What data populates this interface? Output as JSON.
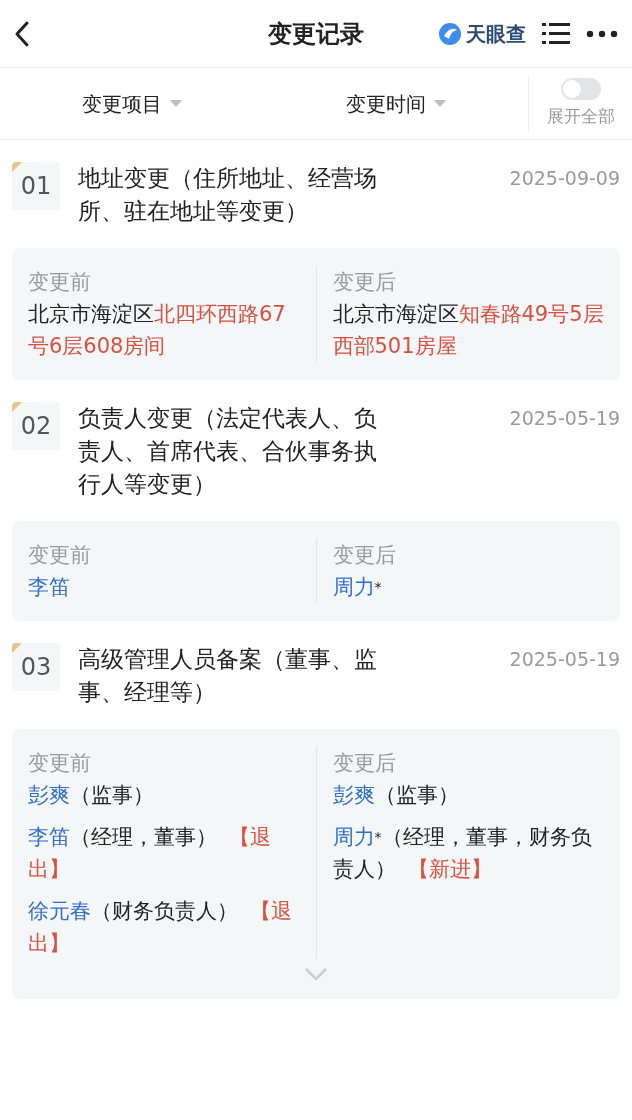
{
  "header": {
    "title": "变更记录",
    "brand": "天眼查"
  },
  "filters": [
    {
      "label": "变更项目"
    },
    {
      "label": "变更时间"
    }
  ],
  "expand_all": {
    "label": "展开全部",
    "on": false
  },
  "records": [
    {
      "number": "01",
      "title": "地址变更（住所地址、经营场所、驻在地址等变更）",
      "date": "2025-09-09",
      "before_label": "变更前",
      "after_label": "变更后",
      "collapsed": false,
      "before": [
        [
          {
            "kind": "plain",
            "text": "北京市海淀区"
          },
          {
            "kind": "highlight",
            "text": "北四环西路67号6层608房间"
          }
        ]
      ],
      "after": [
        [
          {
            "kind": "plain",
            "text": "北京市海淀区"
          },
          {
            "kind": "highlight",
            "text": "知春路49号5层西部501房屋"
          }
        ]
      ]
    },
    {
      "number": "02",
      "title": "负责人变更（法定代表人、负责人、首席代表、合伙事务执行人等变更）",
      "date": "2025-05-19",
      "before_label": "变更前",
      "after_label": "变更后",
      "collapsed": false,
      "before": [
        [
          {
            "kind": "person",
            "text": "李笛"
          }
        ]
      ],
      "after": [
        [
          {
            "kind": "person",
            "text": "周力"
          },
          {
            "kind": "mark",
            "text": "*"
          }
        ]
      ]
    },
    {
      "number": "03",
      "title": "高级管理人员备案（董事、监事、经理等）",
      "date": "2025-05-19",
      "before_label": "变更前",
      "after_label": "变更后",
      "collapsed": true,
      "before": [
        [
          {
            "kind": "person",
            "text": "彭爽"
          },
          {
            "kind": "plain",
            "text": "（监事）"
          }
        ],
        [
          {
            "kind": "person",
            "text": "李笛"
          },
          {
            "kind": "plain",
            "text": "（经理，董事）"
          },
          {
            "kind": "tag",
            "text": "【退出】"
          }
        ],
        [
          {
            "kind": "person",
            "text": "徐元春"
          },
          {
            "kind": "plain",
            "text": "（财务负责人）"
          },
          {
            "kind": "tag",
            "text": "【退出】"
          }
        ]
      ],
      "after": [
        [
          {
            "kind": "person",
            "text": "彭爽"
          },
          {
            "kind": "plain",
            "text": "（监事）"
          }
        ],
        [
          {
            "kind": "person",
            "text": "周力"
          },
          {
            "kind": "mark",
            "text": "*"
          },
          {
            "kind": "plain",
            "text": "（经理，董事，财务负责人）"
          },
          {
            "kind": "tag",
            "text": "【新进】"
          }
        ]
      ]
    }
  ]
}
